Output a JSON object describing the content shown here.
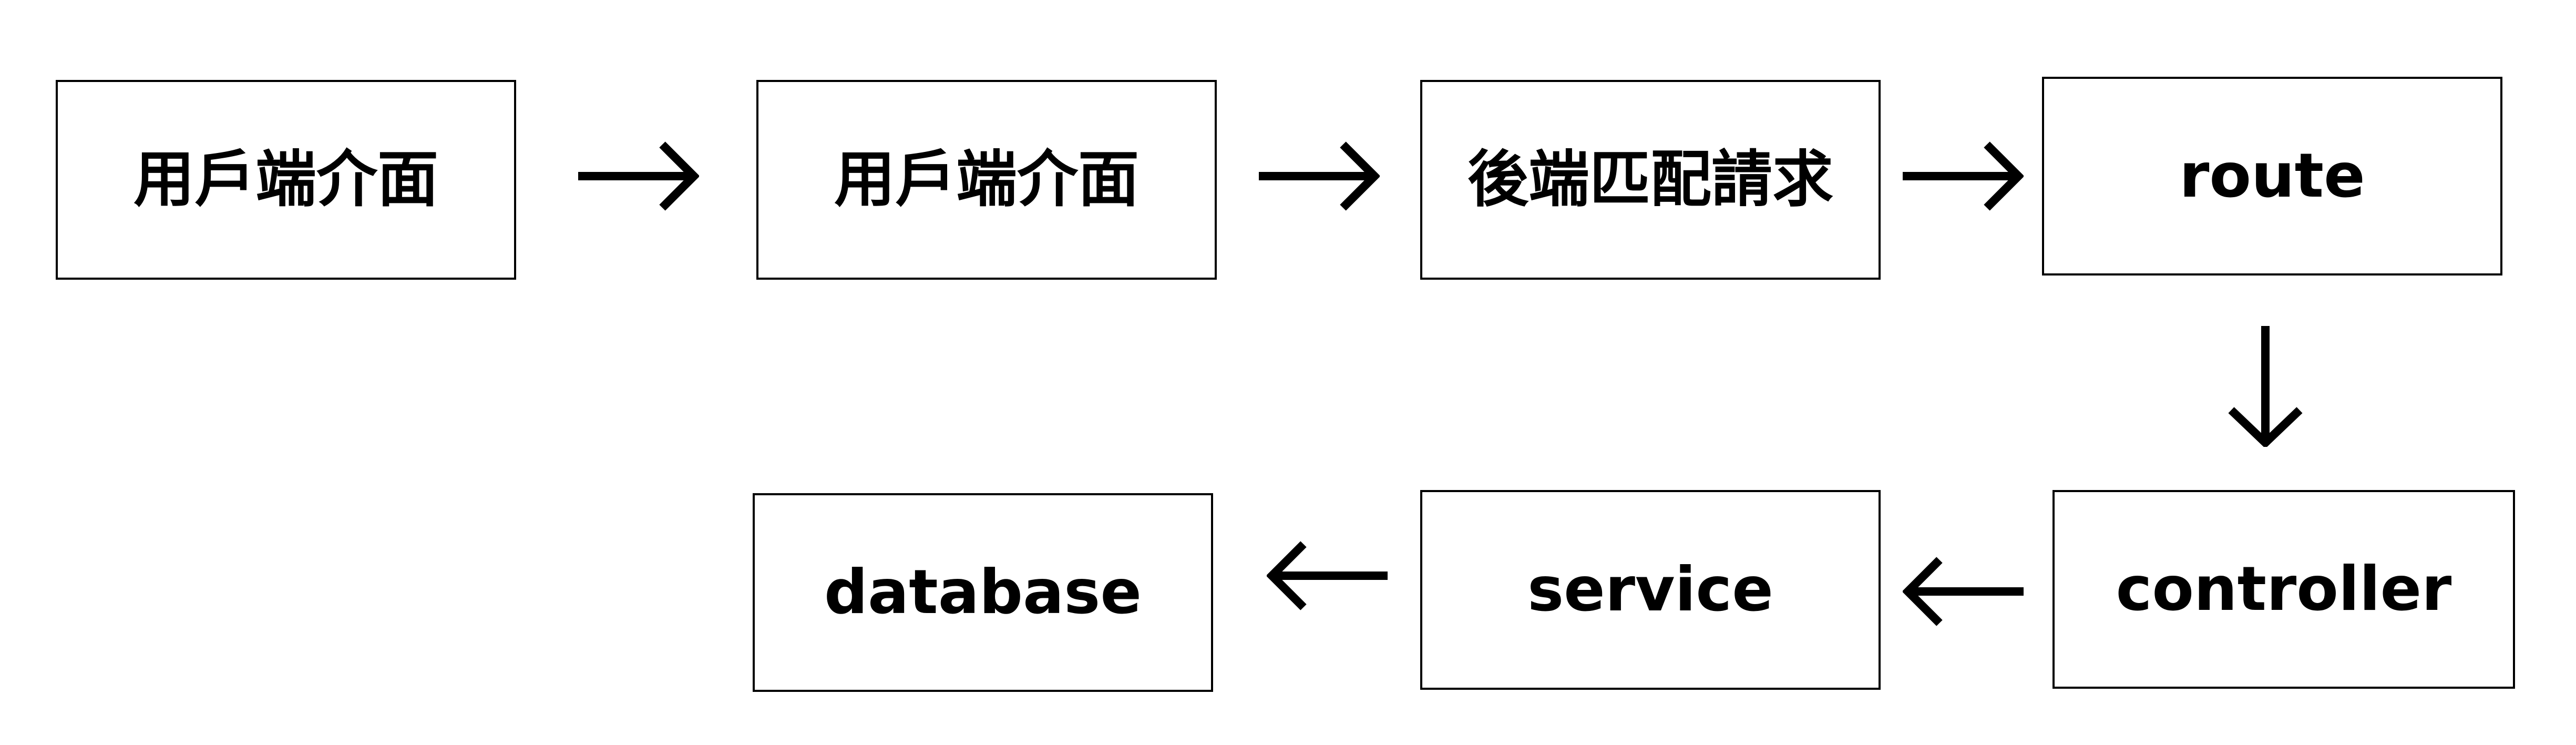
{
  "nodes": {
    "n1": "用戶端介面",
    "n2": "用戶端介面",
    "n3": "後端匹配請求",
    "n4": "route",
    "n5": "controller",
    "n6": "service",
    "n7": "database"
  },
  "edges": [
    {
      "from": "n1",
      "to": "n2",
      "icon": "arrow-right-icon"
    },
    {
      "from": "n2",
      "to": "n3",
      "icon": "arrow-right-icon"
    },
    {
      "from": "n3",
      "to": "n4",
      "icon": "arrow-right-icon"
    },
    {
      "from": "n4",
      "to": "n5",
      "icon": "arrow-down-icon"
    },
    {
      "from": "n5",
      "to": "n6",
      "icon": "arrow-left-icon"
    },
    {
      "from": "n6",
      "to": "n7",
      "icon": "arrow-left-icon"
    }
  ],
  "colors": {
    "stroke": "#000000",
    "background": "#ffffff",
    "text": "#000000"
  }
}
